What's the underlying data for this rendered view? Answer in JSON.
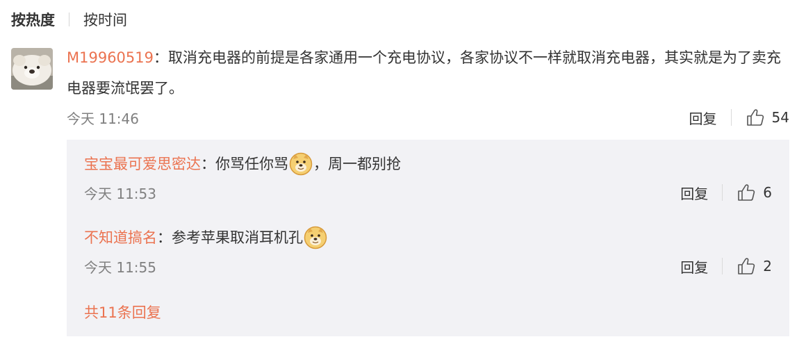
{
  "sort": {
    "hot": "按热度",
    "time": "按时间"
  },
  "comment": {
    "username": "M19960519",
    "sep": "：",
    "text": "取消充电器的前提是各家通用一个充电协议，各家协议不一样就取消充电器，其实就是为了卖充电器要流氓罢了。",
    "time": "今天 11:46",
    "reply_label": "回复",
    "likes": "54"
  },
  "replies": [
    {
      "username": "宝宝最可爱思密达",
      "sep": "：",
      "text_before": "你骂任你骂",
      "emoji": "doge-emoji",
      "text_after": "，周一都别抢",
      "time": "今天 11:53",
      "reply_label": "回复",
      "likes": "6"
    },
    {
      "username": "不知道搞名",
      "sep": "：",
      "text_before": "参考苹果取消耳机孔",
      "emoji": "doge-emoji",
      "text_after": "",
      "time": "今天 11:55",
      "reply_label": "回复",
      "likes": "2"
    }
  ],
  "total_replies": "共11条回复",
  "colors": {
    "accent": "#eb7350",
    "meta": "#808080",
    "reply_bg": "#f2f2f5"
  }
}
